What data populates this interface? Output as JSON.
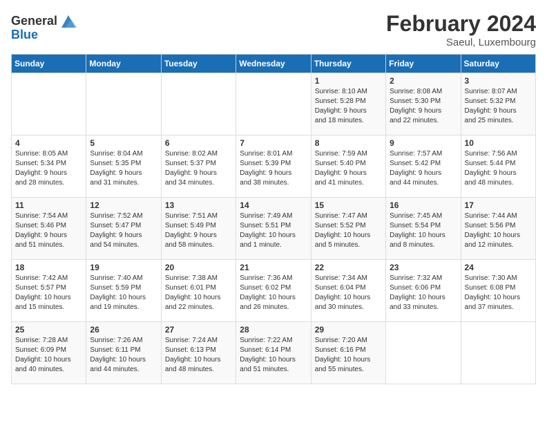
{
  "header": {
    "logo_general": "General",
    "logo_blue": "Blue",
    "month_year": "February 2024",
    "location": "Saeul, Luxembourg"
  },
  "weekdays": [
    "Sunday",
    "Monday",
    "Tuesday",
    "Wednesday",
    "Thursday",
    "Friday",
    "Saturday"
  ],
  "weeks": [
    [
      {
        "day": "",
        "info": ""
      },
      {
        "day": "",
        "info": ""
      },
      {
        "day": "",
        "info": ""
      },
      {
        "day": "",
        "info": ""
      },
      {
        "day": "1",
        "info": "Sunrise: 8:10 AM\nSunset: 5:28 PM\nDaylight: 9 hours\nand 18 minutes."
      },
      {
        "day": "2",
        "info": "Sunrise: 8:08 AM\nSunset: 5:30 PM\nDaylight: 9 hours\nand 22 minutes."
      },
      {
        "day": "3",
        "info": "Sunrise: 8:07 AM\nSunset: 5:32 PM\nDaylight: 9 hours\nand 25 minutes."
      }
    ],
    [
      {
        "day": "4",
        "info": "Sunrise: 8:05 AM\nSunset: 5:34 PM\nDaylight: 9 hours\nand 28 minutes."
      },
      {
        "day": "5",
        "info": "Sunrise: 8:04 AM\nSunset: 5:35 PM\nDaylight: 9 hours\nand 31 minutes."
      },
      {
        "day": "6",
        "info": "Sunrise: 8:02 AM\nSunset: 5:37 PM\nDaylight: 9 hours\nand 34 minutes."
      },
      {
        "day": "7",
        "info": "Sunrise: 8:01 AM\nSunset: 5:39 PM\nDaylight: 9 hours\nand 38 minutes."
      },
      {
        "day": "8",
        "info": "Sunrise: 7:59 AM\nSunset: 5:40 PM\nDaylight: 9 hours\nand 41 minutes."
      },
      {
        "day": "9",
        "info": "Sunrise: 7:57 AM\nSunset: 5:42 PM\nDaylight: 9 hours\nand 44 minutes."
      },
      {
        "day": "10",
        "info": "Sunrise: 7:56 AM\nSunset: 5:44 PM\nDaylight: 9 hours\nand 48 minutes."
      }
    ],
    [
      {
        "day": "11",
        "info": "Sunrise: 7:54 AM\nSunset: 5:46 PM\nDaylight: 9 hours\nand 51 minutes."
      },
      {
        "day": "12",
        "info": "Sunrise: 7:52 AM\nSunset: 5:47 PM\nDaylight: 9 hours\nand 54 minutes."
      },
      {
        "day": "13",
        "info": "Sunrise: 7:51 AM\nSunset: 5:49 PM\nDaylight: 9 hours\nand 58 minutes."
      },
      {
        "day": "14",
        "info": "Sunrise: 7:49 AM\nSunset: 5:51 PM\nDaylight: 10 hours\nand 1 minute."
      },
      {
        "day": "15",
        "info": "Sunrise: 7:47 AM\nSunset: 5:52 PM\nDaylight: 10 hours\nand 5 minutes."
      },
      {
        "day": "16",
        "info": "Sunrise: 7:45 AM\nSunset: 5:54 PM\nDaylight: 10 hours\nand 8 minutes."
      },
      {
        "day": "17",
        "info": "Sunrise: 7:44 AM\nSunset: 5:56 PM\nDaylight: 10 hours\nand 12 minutes."
      }
    ],
    [
      {
        "day": "18",
        "info": "Sunrise: 7:42 AM\nSunset: 5:57 PM\nDaylight: 10 hours\nand 15 minutes."
      },
      {
        "day": "19",
        "info": "Sunrise: 7:40 AM\nSunset: 5:59 PM\nDaylight: 10 hours\nand 19 minutes."
      },
      {
        "day": "20",
        "info": "Sunrise: 7:38 AM\nSunset: 6:01 PM\nDaylight: 10 hours\nand 22 minutes."
      },
      {
        "day": "21",
        "info": "Sunrise: 7:36 AM\nSunset: 6:02 PM\nDaylight: 10 hours\nand 26 minutes."
      },
      {
        "day": "22",
        "info": "Sunrise: 7:34 AM\nSunset: 6:04 PM\nDaylight: 10 hours\nand 30 minutes."
      },
      {
        "day": "23",
        "info": "Sunrise: 7:32 AM\nSunset: 6:06 PM\nDaylight: 10 hours\nand 33 minutes."
      },
      {
        "day": "24",
        "info": "Sunrise: 7:30 AM\nSunset: 6:08 PM\nDaylight: 10 hours\nand 37 minutes."
      }
    ],
    [
      {
        "day": "25",
        "info": "Sunrise: 7:28 AM\nSunset: 6:09 PM\nDaylight: 10 hours\nand 40 minutes."
      },
      {
        "day": "26",
        "info": "Sunrise: 7:26 AM\nSunset: 6:11 PM\nDaylight: 10 hours\nand 44 minutes."
      },
      {
        "day": "27",
        "info": "Sunrise: 7:24 AM\nSunset: 6:13 PM\nDaylight: 10 hours\nand 48 minutes."
      },
      {
        "day": "28",
        "info": "Sunrise: 7:22 AM\nSunset: 6:14 PM\nDaylight: 10 hours\nand 51 minutes."
      },
      {
        "day": "29",
        "info": "Sunrise: 7:20 AM\nSunset: 6:16 PM\nDaylight: 10 hours\nand 55 minutes."
      },
      {
        "day": "",
        "info": ""
      },
      {
        "day": "",
        "info": ""
      }
    ]
  ]
}
